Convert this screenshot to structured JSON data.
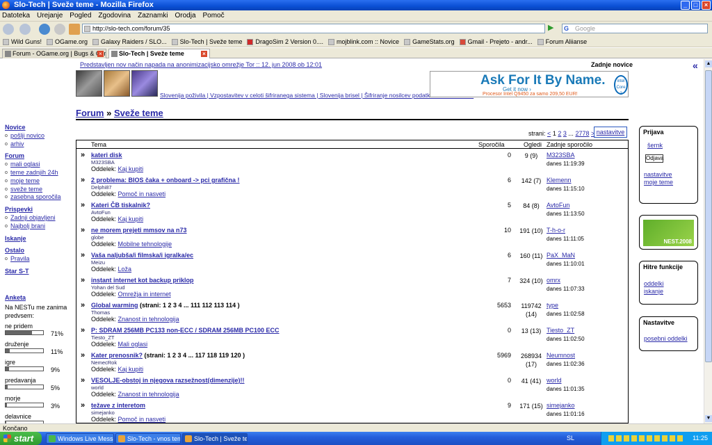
{
  "window": {
    "title": "Slo-Tech | Sveže teme - Mozilla Firefox"
  },
  "menu": [
    "Datoteka",
    "Urejanje",
    "Pogled",
    "Zgodovina",
    "Zaznamki",
    "Orodja",
    "Pomoč"
  ],
  "address": {
    "url": "http://slo-tech.com/forum/35",
    "search_placeholder": "Google"
  },
  "bookmarks": [
    "Wild Guns!",
    "OGame.org",
    "Galaxy Raiders / SLO...",
    "Slo-Tech | Sveže teme",
    "DragoSim 2 Version 0....",
    "mojblink.com :: Novice",
    "GameStats.org",
    "Gmail - Prejeto - andr...",
    "Forum Aliianse"
  ],
  "tabs": [
    "Forum - OGame.org | Bugs & Complaints",
    "Slo-Tech | Sveže teme"
  ],
  "page": {
    "top_news": "Predstavljen nov način napada na anonimizacijsko omrežje Tor :: 12. jun 2008 ob 12:01",
    "latest_news_heading": "Zadnje novice",
    "collapse_glyph": "«",
    "news_captions": "Slovenija poživila | Vzpostavitev v celoti šifriranega sistema | Slovenija brisel | Šifriranje nosilcev podatkov v okoliu Linux",
    "ad": {
      "headline": "Ask For It By Name.",
      "sub": "Get it now ›",
      "price": "Procesor Intel Q9450 za samo 209,50 EUR!",
      "logo": "intel Core 2"
    },
    "breadcrumb": {
      "forum": "Forum",
      "sep": "»",
      "section": "Sveže teme"
    },
    "pager": {
      "label": "strani:",
      "prev": "<",
      "pages": [
        "1",
        "2",
        "3",
        "...",
        "2778"
      ],
      "next": ">",
      "settings": "nastavitve"
    },
    "columns": {
      "topic": "Tema",
      "replies": "Sporočila",
      "views": "Ogledi",
      "last": "Zadnje sporočilo"
    },
    "section_label": "Oddelek:",
    "topics": [
      {
        "title": "kateri disk",
        "pages": "",
        "author": "M323SBA",
        "section": "Kaj kupiti",
        "replies": "0",
        "views": "9 (9)",
        "last_user": "M323SBA",
        "last_time": "danes 11:19:39"
      },
      {
        "title": "2 problema: BIOS čaka + onboard -> pci grafična !",
        "pages": "",
        "author": "Delphi87",
        "section": "Pomoč in nasveti",
        "replies": "6",
        "views": "142 (7)",
        "last_user": "Klemenn",
        "last_time": "danes 11:15:10"
      },
      {
        "title": "Kateri ČB tiskalnik?",
        "pages": "",
        "author": "AvtoFun",
        "section": "Kaj kupiti",
        "replies": "5",
        "views": "84 (8)",
        "last_user": "AvtoFun",
        "last_time": "danes 11:13:50"
      },
      {
        "title": "ne morem prejeti mmsov na n73",
        "pages": "",
        "author": "globe",
        "section": "Mobilne tehnologije",
        "replies": "10",
        "views": "191 (10)",
        "last_user": "T-h-o-r",
        "last_time": "danes 11:11:05"
      },
      {
        "title": "Vaša naljubša/i filmska/i igralka/ec",
        "pages": "",
        "author": "Meizu",
        "section": "Loža",
        "replies": "6",
        "views": "160 (11)",
        "last_user": "PaX_MaN",
        "last_time": "danes 11:10:01"
      },
      {
        "title": "instant internet kot backup priklop",
        "pages": "",
        "author": "Yohan del Sud",
        "section": "Omrežja in internet",
        "replies": "7",
        "views": "324 (10)",
        "last_user": "omrx",
        "last_time": "danes 11:07:33"
      },
      {
        "title": "Global warming",
        "pages": "(strani: 1 2 3 4 ... 111 112 113 114 )",
        "author": "Thomas",
        "section": "Znanost in tehnologija",
        "replies": "5653",
        "views": "119742 (14)",
        "last_user": "type",
        "last_time": "danes 11:02:58"
      },
      {
        "title": "P: SDRAM 256MB PC133 non-ECC / SDRAM 256MB PC100 ECC",
        "pages": "",
        "author": "Tiesto_ZT",
        "section": "Mali oglasi",
        "replies": "0",
        "views": "13 (13)",
        "last_user": "Tiesto_ZT",
        "last_time": "danes 11:02:50"
      },
      {
        "title": "Kater prenosnik?",
        "pages": "(strani: 1 2 3 4 ... 117 118 119 120 )",
        "author": "NemecRok",
        "section": "Kaj kupiti",
        "replies": "5969",
        "views": "268934 (17)",
        "last_user": "Neumnost",
        "last_time": "danes 11:02:36"
      },
      {
        "title": "VESOLJE-obstoj in njegova razsežnost(dimenzije)!!",
        "pages": "",
        "author": "world",
        "section": "Znanost in tehnologija",
        "replies": "0",
        "views": "41 (41)",
        "last_user": "world",
        "last_time": "danes 11:01:35"
      },
      {
        "title": "težave z interetom",
        "pages": "",
        "author": "simejanko",
        "section": "Pomoč in nasveti",
        "replies": "9",
        "views": "171 (15)",
        "last_user": "simejanko",
        "last_time": "danes 11:01:16"
      }
    ],
    "left_nav": [
      {
        "heading": "Novice",
        "items": [
          "pošlji novico",
          "arhiv"
        ]
      },
      {
        "heading": "Forum",
        "items": [
          "mali oglasi",
          "teme zadnjih 24h",
          "moje teme",
          "sveže teme",
          "zasebna sporočila"
        ]
      },
      {
        "heading": "Prispevki",
        "items": [
          "Zadnji objavljeni",
          "Najbolj brani"
        ]
      },
      {
        "heading": "Iskanje",
        "items": []
      },
      {
        "heading": "Ostalo",
        "items": [
          "Pravila"
        ]
      },
      {
        "heading": "Star S-T",
        "items": []
      }
    ],
    "poll": {
      "title": "Anketa",
      "question": "Na NESTu me zanima predvsem:",
      "options": [
        {
          "label": "ne pridem",
          "pct": "71%",
          "value": 0.71
        },
        {
          "label": "druženje",
          "pct": "11%",
          "value": 0.11
        },
        {
          "label": "igre",
          "pct": "9%",
          "value": 0.09
        },
        {
          "label": "predavanja",
          "pct": "5%",
          "value": 0.05
        },
        {
          "label": "morje",
          "pct": "3%",
          "value": 0.03
        },
        {
          "label": "delavnice",
          "pct": "",
          "value": 0.01
        }
      ]
    },
    "login_box": {
      "title": "Prijava",
      "user": "šernk",
      "logout": "Odjava",
      "links": [
        "nastavitve",
        "moje teme"
      ]
    },
    "nest_banner": "NEST.2008",
    "quick_box": {
      "title": "Hitre funkcije",
      "links": [
        "oddelki",
        "iskanje"
      ]
    },
    "settings_box": {
      "title": "Nastavitve",
      "links": [
        "posebni oddelki"
      ]
    }
  },
  "status_bar": "Končano",
  "taskbar": {
    "start": "start",
    "items": [
      "Windows Live Messen...",
      "Slo-Tech - vnos teme ...",
      "Slo-Tech | Sveže tem..."
    ],
    "lang": "SL",
    "clock": "11:25"
  }
}
